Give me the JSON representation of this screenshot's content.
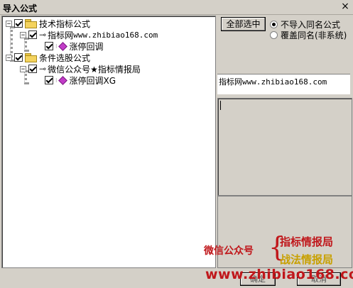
{
  "window": {
    "title": "导入公式",
    "close_glyph": "×"
  },
  "tree": {
    "nodes": [
      {
        "expander": "−",
        "label": "技术指标公式",
        "type": "folder",
        "checked": true
      },
      {
        "expander": "−",
        "label_prefix": "指标网",
        "label_mono": "www.zhibiao168.com",
        "type": "key",
        "checked": true
      },
      {
        "label": "涨停回调",
        "type": "formula",
        "checked": true
      },
      {
        "expander": "−",
        "label": "条件选股公式",
        "type": "folder",
        "checked": true
      },
      {
        "expander": "−",
        "label": "微信公众号★指标情报局",
        "type": "key",
        "checked": true
      },
      {
        "label": "涨停回调XG",
        "type": "formula",
        "checked": true
      }
    ]
  },
  "options": {
    "select_all_label": "全部选中",
    "radio_no_import": "不导入同名公式",
    "radio_overwrite": "覆盖同名(非系统)",
    "selected": "no_import"
  },
  "info": {
    "text_prefix": "指标网",
    "text_mono": "www.zhibiao168.com"
  },
  "watermark": {
    "wechat": "微信公众号",
    "brace": "{",
    "line1": "指标情报局",
    "line2": "战法情报局",
    "url": "www.zhibiao168.com"
  },
  "buttons": {
    "ok": "确定",
    "cancel": "取消"
  },
  "colors": {
    "watermark_red": "#c0171b",
    "watermark_gold": "#c8a000",
    "face": "#d4d0c8"
  }
}
